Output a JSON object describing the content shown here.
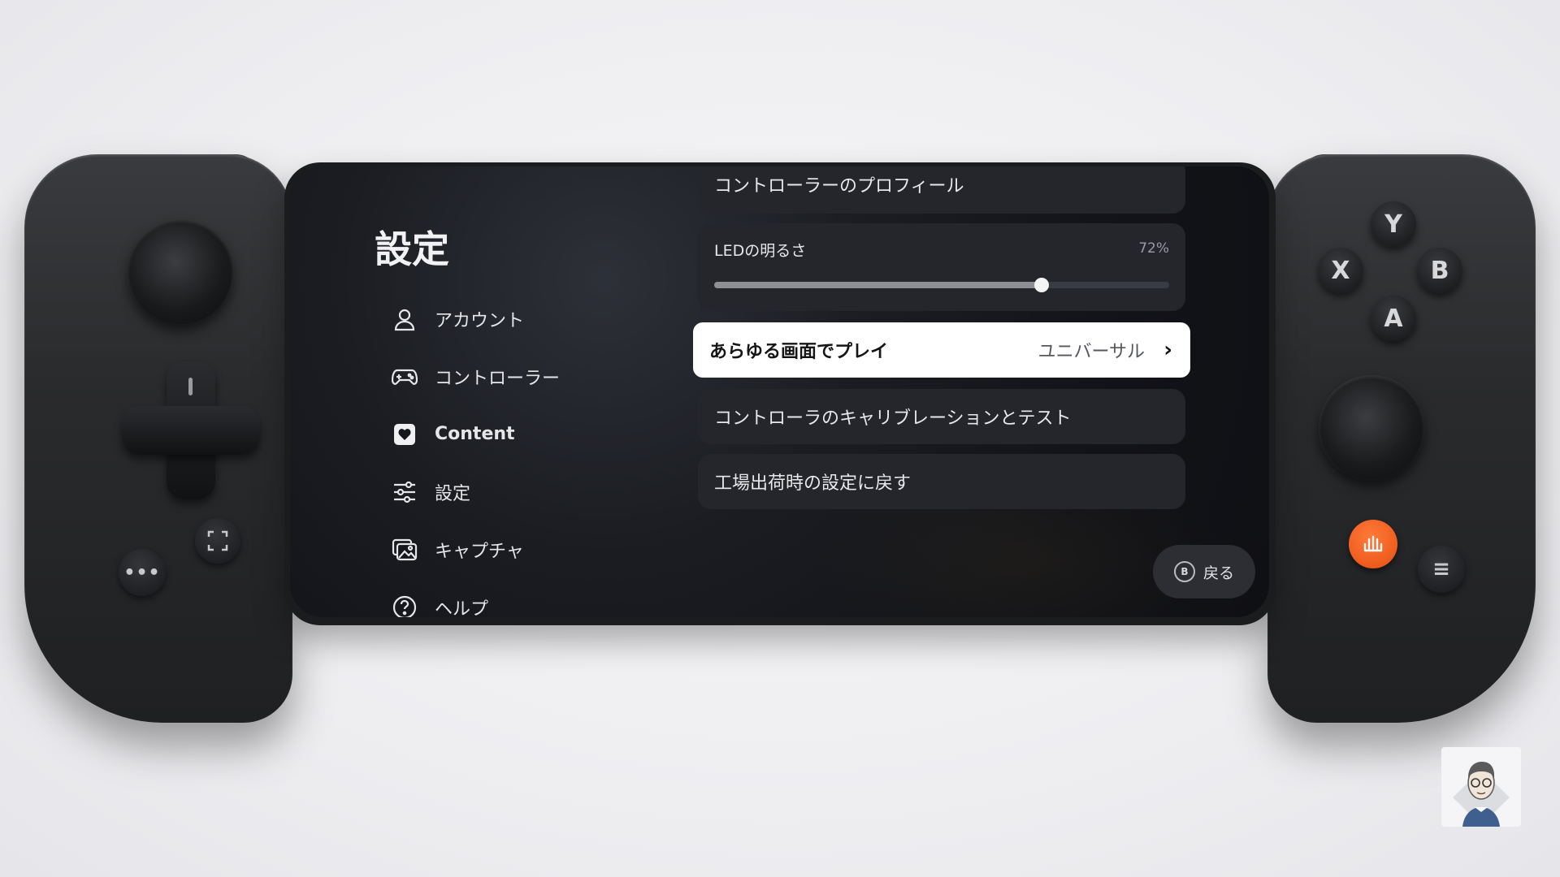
{
  "screen": {
    "title": "設定",
    "nav": [
      {
        "label": "アカウント",
        "icon": "person-icon"
      },
      {
        "label": "コントローラー",
        "icon": "gamepad-icon"
      },
      {
        "label": "Content",
        "icon": "heart-badge-icon",
        "active": true
      },
      {
        "label": "設定",
        "icon": "sliders-icon"
      },
      {
        "label": "キャプチャ",
        "icon": "gallery-icon"
      },
      {
        "label": "ヘルプ",
        "icon": "help-icon"
      }
    ],
    "settings": {
      "controller_profile": "コントローラーのプロフィール",
      "led": {
        "label": "LEDの明るさ",
        "value_text": "72%",
        "value": 0.72
      },
      "universal": {
        "label": "あらゆる画面でプレイ",
        "value": "ユニバーサル"
      },
      "calibration": "コントローラのキャリブレーションとテスト",
      "factory_reset": "工場出荷時の設定に戻す"
    },
    "back": {
      "button_glyph": "B",
      "label": "戻る"
    }
  },
  "controller": {
    "face_buttons": {
      "y": "Y",
      "x": "X",
      "b": "B",
      "a": "A"
    },
    "home_color": "#f26522"
  },
  "colors": {
    "screen_bg": "#15171c",
    "panel_bg": "#24262c",
    "highlight_bg": "#ffffff"
  }
}
